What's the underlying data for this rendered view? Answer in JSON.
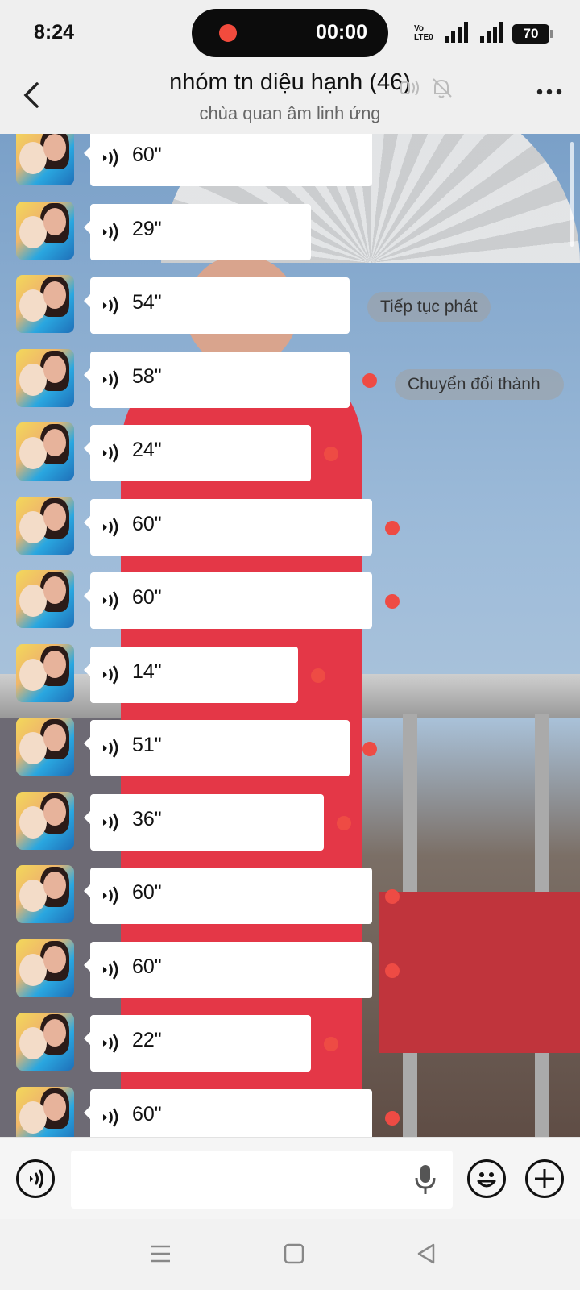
{
  "status_bar": {
    "time": "8:24",
    "recording_timer": "00:00",
    "network": "Vo LTE0",
    "battery": "70"
  },
  "header": {
    "title": "nhóm tn diệu hạnh (46)",
    "subtitle": "chùa quan âm linh ứng"
  },
  "messages": [
    {
      "duration": "60\"",
      "unread": false
    },
    {
      "duration": "29\"",
      "unread": false
    },
    {
      "duration": "54\"",
      "unread": false
    },
    {
      "duration": "58\"",
      "unread": true
    },
    {
      "duration": "24\"",
      "unread": true
    },
    {
      "duration": "60\"",
      "unread": true
    },
    {
      "duration": "60\"",
      "unread": true
    },
    {
      "duration": "14\"",
      "unread": true
    },
    {
      "duration": "51\"",
      "unread": true
    },
    {
      "duration": "36\"",
      "unread": true
    },
    {
      "duration": "60\"",
      "unread": true
    },
    {
      "duration": "60\"",
      "unread": true
    },
    {
      "duration": "22\"",
      "unread": true
    },
    {
      "duration": "60\"",
      "unread": true
    }
  ],
  "actions": {
    "continue_play": "Tiếp tục phát",
    "convert_to_text": "Chuyển đổi thành văn bản"
  },
  "input": {
    "placeholder": ""
  },
  "colors": {
    "unread_dot": "#ee4b44",
    "recording_dot": "#f24b3d",
    "bubble": "#ffffff"
  }
}
